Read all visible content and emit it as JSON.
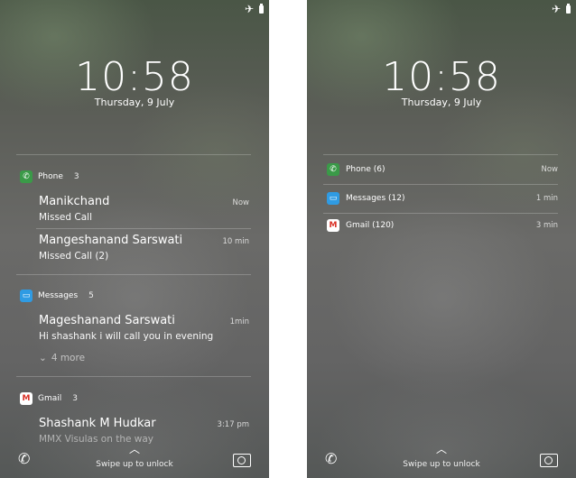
{
  "left": {
    "time": "10:58",
    "date": "Thursday, 9 July",
    "groups": [
      {
        "app": "Phone",
        "count": "3",
        "items": [
          {
            "title": "Manikchand",
            "body": "Missed Call",
            "time": "Now"
          },
          {
            "title": "Mangeshanand Sarswati",
            "body": "Missed Call (2)",
            "time": "10 min"
          }
        ]
      },
      {
        "app": "Messages",
        "count": "5",
        "items": [
          {
            "title": "Mageshanand Sarswati",
            "body": "Hi shashank i will call you in evening",
            "time": "1min"
          }
        ],
        "more": "4 more"
      },
      {
        "app": "Gmail",
        "count": "3",
        "items": [
          {
            "title": "Shashank M Hudkar",
            "body": "MMX Visulas on the way",
            "time": "3:17 pm"
          }
        ]
      }
    ],
    "swipe_text": "Swipe up to unlock"
  },
  "right": {
    "time": "10:58",
    "date": "Thursday, 9 July",
    "rows": [
      {
        "label": "Phone (6)",
        "time": "Now"
      },
      {
        "label": "Messages (12)",
        "time": "1 min"
      },
      {
        "label": "Gmail (120)",
        "time": "3 min"
      }
    ],
    "swipe_text": "Swipe up to unlock"
  },
  "icons": {
    "phone_color": "#3a9a48",
    "messages_color": "#2f9be3",
    "gmail_bg": "#ffffff",
    "gmail_color": "#d93025"
  }
}
